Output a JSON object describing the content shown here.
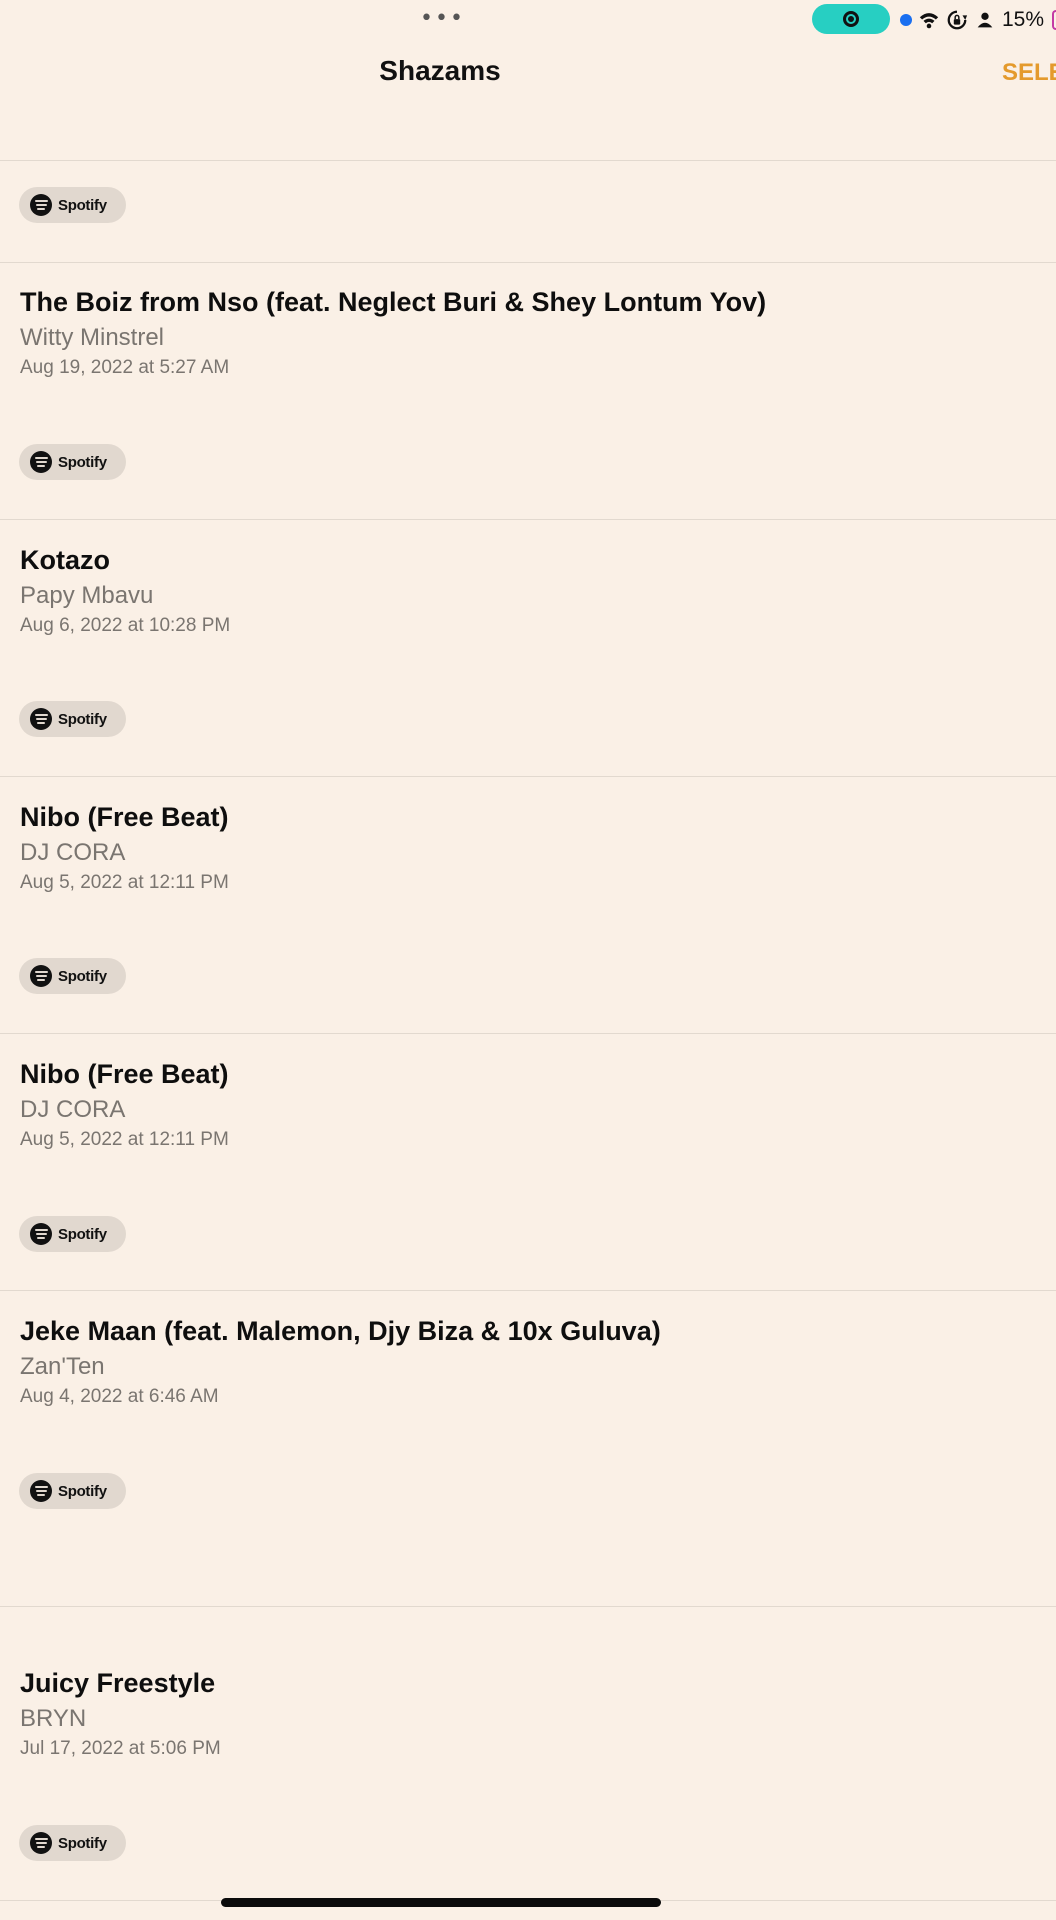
{
  "status_bar": {
    "battery_percent": "15%",
    "multitask_dots": "•••",
    "icons": [
      "screen-record-icon",
      "location-dot-icon",
      "wifi-icon",
      "orientation-lock-icon",
      "person-icon",
      "battery-icon"
    ]
  },
  "nav": {
    "title": "Shazams",
    "select_label": "SELECT"
  },
  "spotify_label": "Spotify",
  "songs": [
    {
      "title": "The Boiz from Nso (feat. Neglect Buri & Shey Lontum Yov)",
      "artist": "Witty Minstrel",
      "date": "Aug 19, 2022 at 5:27 AM"
    },
    {
      "title": "Kotazo",
      "artist": "Papy Mbavu",
      "date": "Aug 6, 2022 at 10:28 PM"
    },
    {
      "title": "Nibo (Free Beat)",
      "artist": "DJ CORA",
      "date": "Aug 5, 2022 at 12:11 PM"
    },
    {
      "title": "Nibo (Free Beat)",
      "artist": "DJ CORA",
      "date": "Aug 5, 2022 at 12:11 PM"
    },
    {
      "title": "Jeke Maan (feat. Malemon, Djy Biza & 10x Guluva)",
      "artist": "Zan'Ten",
      "date": "Aug 4, 2022 at 6:46 AM"
    },
    {
      "title": "Juicy Freestyle",
      "artist": "BRYN",
      "date": "Jul 17, 2022 at 5:06 PM"
    }
  ],
  "colors": {
    "background": "#faf0e6",
    "accent": "#e49a2c",
    "record_pill": "#27cfc2",
    "pill_bg": "#e1d8cf"
  }
}
